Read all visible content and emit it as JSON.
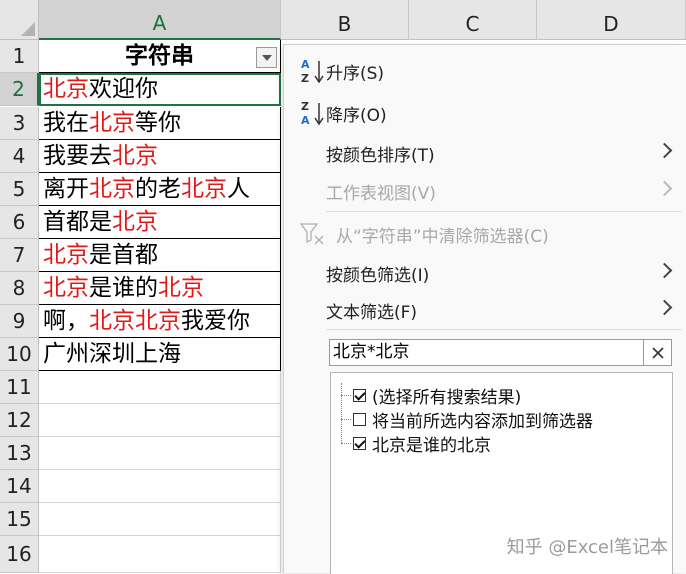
{
  "columns": [
    "A",
    "B",
    "C",
    "D"
  ],
  "rows": [
    "1",
    "2",
    "3",
    "4",
    "5",
    "6",
    "7",
    "8",
    "9",
    "10",
    "11",
    "12",
    "13",
    "14",
    "15",
    "16"
  ],
  "header_cell": "字符串",
  "cells": [
    [
      {
        "t": "北京",
        "h": true
      },
      {
        "t": "欢迎你",
        "h": false
      }
    ],
    [
      {
        "t": "我在",
        "h": false
      },
      {
        "t": "北京",
        "h": true
      },
      {
        "t": "等你",
        "h": false
      }
    ],
    [
      {
        "t": "我要去",
        "h": false
      },
      {
        "t": "北京",
        "h": true
      }
    ],
    [
      {
        "t": "离开",
        "h": false
      },
      {
        "t": "北京",
        "h": true
      },
      {
        "t": "的老",
        "h": false
      },
      {
        "t": "北京",
        "h": true
      },
      {
        "t": "人",
        "h": false
      }
    ],
    [
      {
        "t": "首都是",
        "h": false
      },
      {
        "t": "北京",
        "h": true
      }
    ],
    [
      {
        "t": "北京",
        "h": true
      },
      {
        "t": "是首都",
        "h": false
      }
    ],
    [
      {
        "t": "北京",
        "h": true
      },
      {
        "t": "是谁的",
        "h": false
      },
      {
        "t": "北京",
        "h": true
      }
    ],
    [
      {
        "t": "啊，",
        "h": false
      },
      {
        "t": "北京北京",
        "h": true
      },
      {
        "t": "我爱你",
        "h": false
      }
    ],
    [
      {
        "t": "广州深圳上海",
        "h": false
      }
    ]
  ],
  "menu": {
    "sort_asc": "升序(S)",
    "sort_desc": "降序(O)",
    "sort_by_color": "按颜色排序(T)",
    "sheet_view": "工作表视图(V)",
    "clear_filter": "从“字符串”中清除筛选器(C)",
    "filter_by_color": "按颜色筛选(I)",
    "text_filter": "文本筛选(F)",
    "search_value": "北京*北京",
    "list": [
      {
        "label": "(选择所有搜索结果)",
        "checked": true
      },
      {
        "label": "将当前所选内容添加到筛选器",
        "checked": false
      },
      {
        "label": "北京是谁的北京",
        "checked": true
      }
    ]
  },
  "watermark": "知乎 @Excel笔记本",
  "colors": {
    "highlight": "#e11919",
    "accent": "#217346",
    "sort_blue": "#1f6fc7"
  }
}
